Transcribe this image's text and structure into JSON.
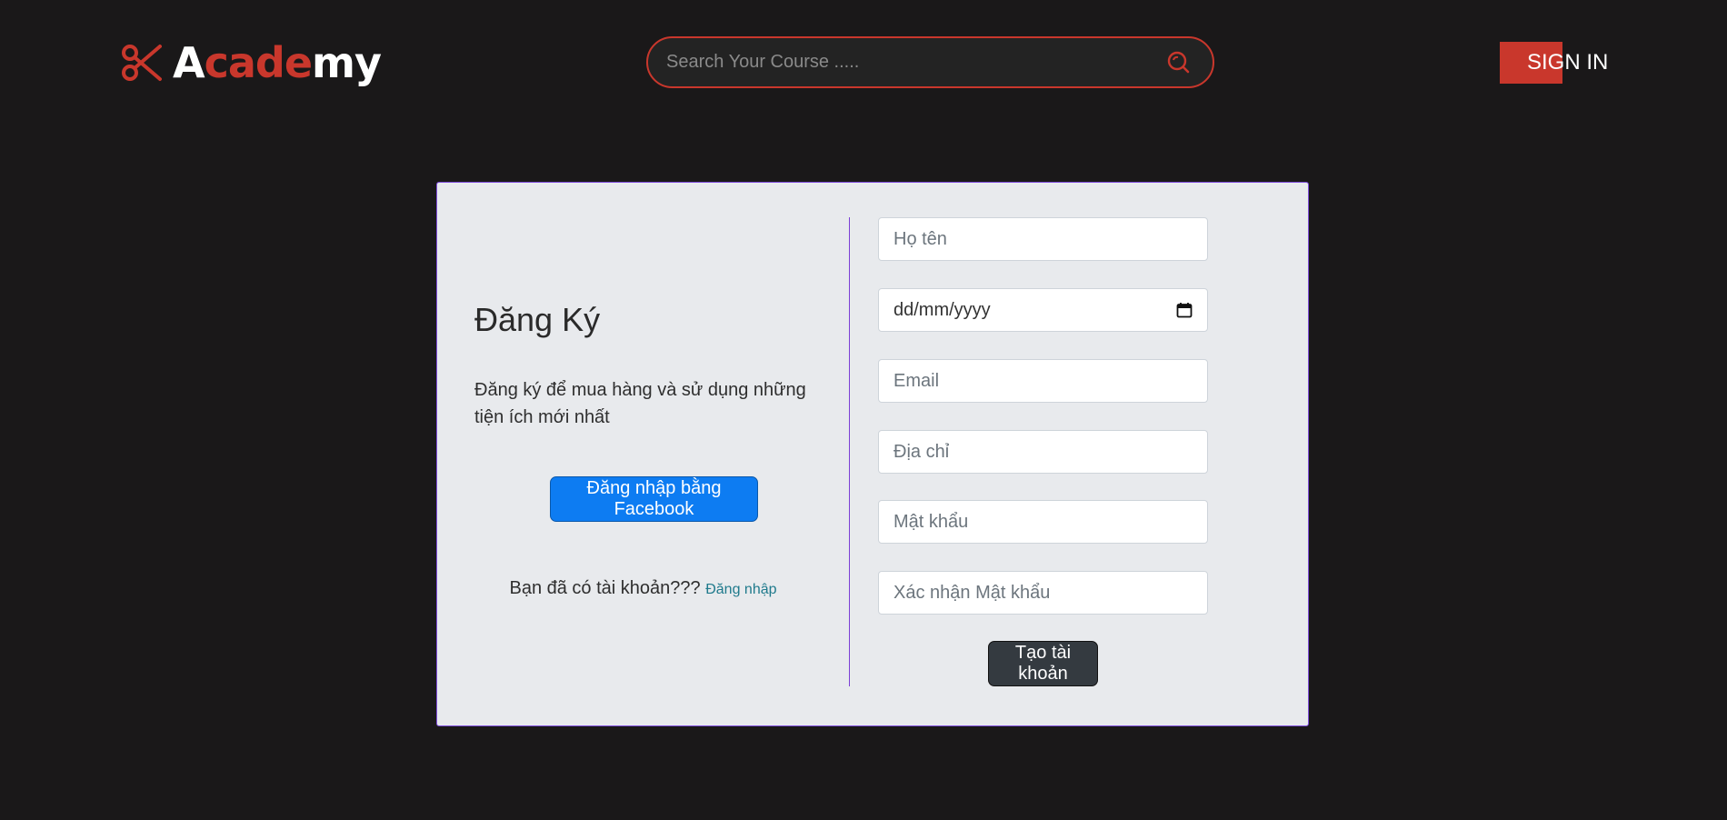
{
  "header": {
    "logo": {
      "icon": "scissors-icon",
      "text_parts": [
        {
          "text": "A",
          "color": "#ffffff"
        },
        {
          "text": "cade",
          "color": "#c9372c"
        },
        {
          "text": "my",
          "color": "#ffffff"
        }
      ]
    },
    "search": {
      "placeholder": "Search Your Course .....",
      "value": "",
      "icon": "search-icon"
    },
    "signin_label": "SIGN IN"
  },
  "colors": {
    "background": "#1a1819",
    "accent_red": "#c9372c",
    "card_bg": "#e8eaed",
    "card_border": "#7e4ddb",
    "facebook_blue": "#0d7cf2",
    "dark_button": "#343a40"
  },
  "signup": {
    "title": "Đăng Ký",
    "description": "Đăng ký để mua hàng và sử dụng những tiện ích mới nhất",
    "facebook_button": "Đăng nhập bằng Facebook",
    "have_account_text": "Bạn đã có tài khoản???",
    "login_link": "Đăng nhập",
    "form": {
      "fullname_placeholder": "Họ tên",
      "dob_value": "dd/mm/yyyy",
      "email_placeholder": "Email",
      "address_placeholder": "Địa chỉ",
      "password_placeholder": "Mật khẩu",
      "confirm_password_placeholder": "Xác nhận Mật khẩu",
      "submit_label": "Tạo tài khoản"
    }
  }
}
